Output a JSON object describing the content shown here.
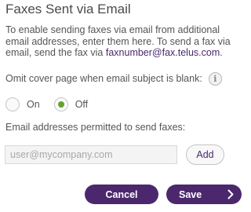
{
  "header": {
    "title": "Faxes Sent via Email"
  },
  "description": {
    "text_before": "To enable sending faxes via email from additional email addresses, enter them here. To send a fax via email, send the fax via ",
    "link": "faxnumber@fax.telus.com",
    "text_after": "."
  },
  "omit_cover": {
    "label": "Omit cover page when email subject is blank:",
    "info_icon": "info-icon",
    "options": [
      {
        "label": "On",
        "selected": false
      },
      {
        "label": "Off",
        "selected": true
      }
    ]
  },
  "permitted": {
    "label": "Email addresses permitted to send faxes:",
    "input_placeholder": "user@mycompany.com",
    "input_value": "",
    "add_label": "Add"
  },
  "footer": {
    "cancel_label": "Cancel",
    "save_label": "Save",
    "save_icon": "chevron-right-icon"
  },
  "colors": {
    "brand_purple": "#4b286d",
    "radio_green": "#66a12e"
  }
}
